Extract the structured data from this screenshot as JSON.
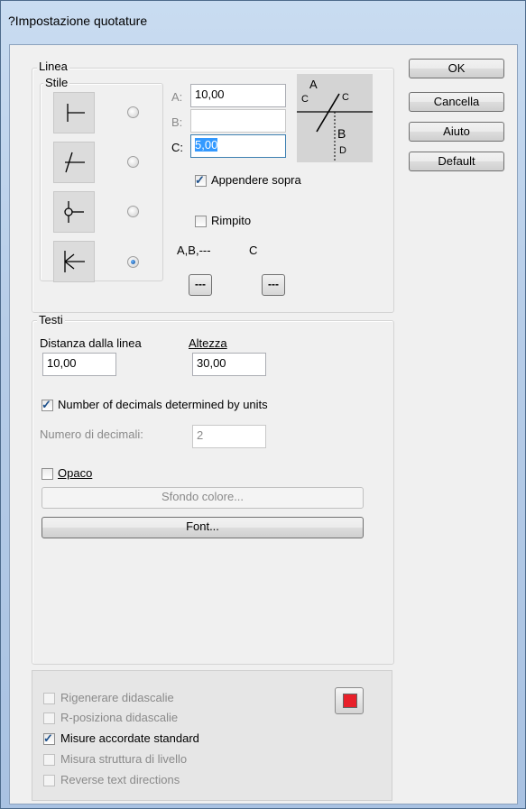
{
  "window": {
    "title": "?Impostazione quotature"
  },
  "buttons": {
    "ok": "OK",
    "cancel": "Cancella",
    "help": "Aiuto",
    "default": "Default"
  },
  "linea": {
    "group_label": "Linea",
    "stile_label": "Stile",
    "styles": [
      {
        "icon": "tee-icon",
        "selected": false
      },
      {
        "icon": "slash-arrow-icon",
        "selected": false
      },
      {
        "icon": "circle-arrow-icon",
        "selected": false
      },
      {
        "icon": "arrow-left-icon",
        "selected": true
      }
    ],
    "field_a_label": "A:",
    "field_a_value": "10,00",
    "field_b_label": "B:",
    "field_b_value": "",
    "field_c_label": "C:",
    "field_c_value": "5,00",
    "preview": {
      "a": "A",
      "b": "B",
      "c_left": "C",
      "c_right": "C",
      "d": "D"
    },
    "append_label": "Appendere sopra",
    "append_checked": true,
    "fill_label": "Rimpito",
    "fill_checked": false,
    "abc_label": "A,B,---",
    "c_label": "C",
    "dots_label": "---"
  },
  "testi": {
    "group_label": "Testi",
    "distance_label": "Distanza dalla linea",
    "distance_value": "10,00",
    "height_label": "Altezza",
    "height_value": "30,00",
    "decimals_units_label": "Number of decimals determined by units",
    "decimals_units_checked": true,
    "decimals_label": "Numero di decimali:",
    "decimals_value": "2",
    "opaque_label": "Opaco",
    "opaque_checked": false,
    "bg_color_button": "Sfondo colore...",
    "font_button": "Font..."
  },
  "options": [
    {
      "label": "Rigenerare didascalie",
      "checked": false,
      "enabled": false
    },
    {
      "label": "R-posiziona didascalie",
      "checked": false,
      "enabled": false
    },
    {
      "label": "Misure accordate standard",
      "checked": true,
      "enabled": true
    },
    {
      "label": "Misura struttura di livello",
      "checked": false,
      "enabled": false
    },
    {
      "label": "Reverse text directions",
      "checked": false,
      "enabled": false
    }
  ],
  "colors": {
    "color_swatch": "#e8202a"
  }
}
